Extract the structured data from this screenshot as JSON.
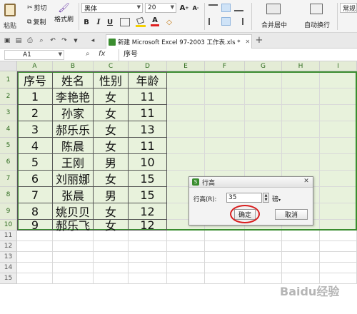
{
  "ribbon": {
    "paste_label": "粘贴",
    "cut_label": "剪切",
    "copy_label": "复制",
    "format_painter_label": "格式刷",
    "font_name": "黑体",
    "font_size": "20",
    "bold": "B",
    "italic": "I",
    "underline": "U",
    "font_color_glyph": "A",
    "grow_font": "A",
    "shrink_font": "A",
    "merge_center_label": "合并居中",
    "wrap_text_label": "自动换行",
    "number_format": "常规"
  },
  "tabbar": {
    "doc_title": "新建 Microsoft Excel 97-2003 工作表.xls *",
    "new_tab": "+"
  },
  "formula_bar": {
    "name_box": "A1",
    "fx": "fx",
    "content": "序号"
  },
  "columns": [
    "A",
    "B",
    "C",
    "D",
    "E",
    "F",
    "G",
    "H",
    "I"
  ],
  "rows": [
    "1",
    "2",
    "3",
    "4",
    "5",
    "6",
    "7",
    "8",
    "9",
    "10",
    "11",
    "12",
    "13",
    "14",
    "15"
  ],
  "table": {
    "headers": [
      "序号",
      "姓名",
      "性别",
      "年龄"
    ],
    "rows": [
      [
        "1",
        "李艳艳",
        "女",
        "11"
      ],
      [
        "2",
        "孙家",
        "女",
        "11"
      ],
      [
        "3",
        "郝乐乐",
        "女",
        "13"
      ],
      [
        "4",
        "陈晨",
        "女",
        "11"
      ],
      [
        "5",
        "王刚",
        "男",
        "10"
      ],
      [
        "6",
        "刘丽娜",
        "女",
        "15"
      ],
      [
        "7",
        "张晨",
        "男",
        "15"
      ],
      [
        "8",
        "姚贝贝",
        "女",
        "12"
      ],
      [
        "9",
        "郝乐飞",
        "女",
        "12"
      ]
    ]
  },
  "dialog": {
    "title": "行高",
    "label": "行高(R):",
    "value": "35",
    "unit": "磅",
    "ok": "确定",
    "cancel": "取消"
  },
  "watermark": "Baidu经验",
  "colors": {
    "accent_green": "#3a8d2f",
    "selection_fill": "#e8f2dc",
    "highlight_circle": "#d81e1e"
  }
}
